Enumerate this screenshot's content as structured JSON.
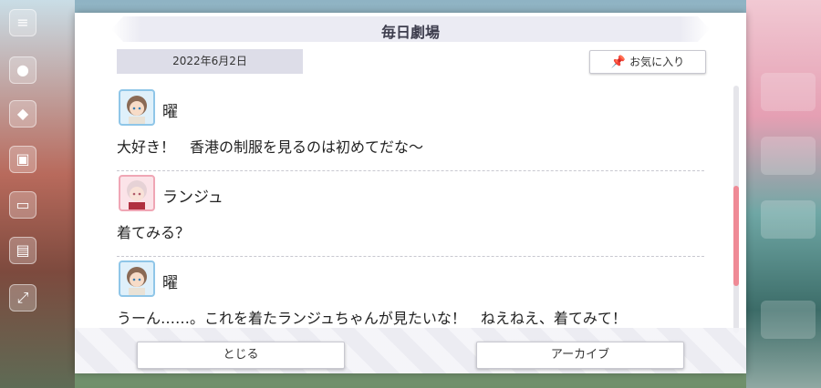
{
  "dialog": {
    "title": "毎日劇場",
    "date": "2022年6月2日",
    "favorite_label": "お気に入り",
    "close_label": "とじる",
    "archive_label": "アーカイブ"
  },
  "entries": [
    {
      "speaker": "曜",
      "text": "大好き！　香港の制服を見るのは初めてだな～"
    },
    {
      "speaker": "ランジュ",
      "text": "着てみる？"
    },
    {
      "speaker": "曜",
      "text": "うーん……。これを着たランジュちゃんが見たいな！　ねえねえ、着てみて！"
    }
  ],
  "icons": {
    "menu": "menu-icon",
    "pin": "pin-icon"
  },
  "colors": {
    "accent_scroll": "#ef8a96",
    "avatar_blue": "#8fc6e8",
    "avatar_pink": "#f0a6b5"
  }
}
